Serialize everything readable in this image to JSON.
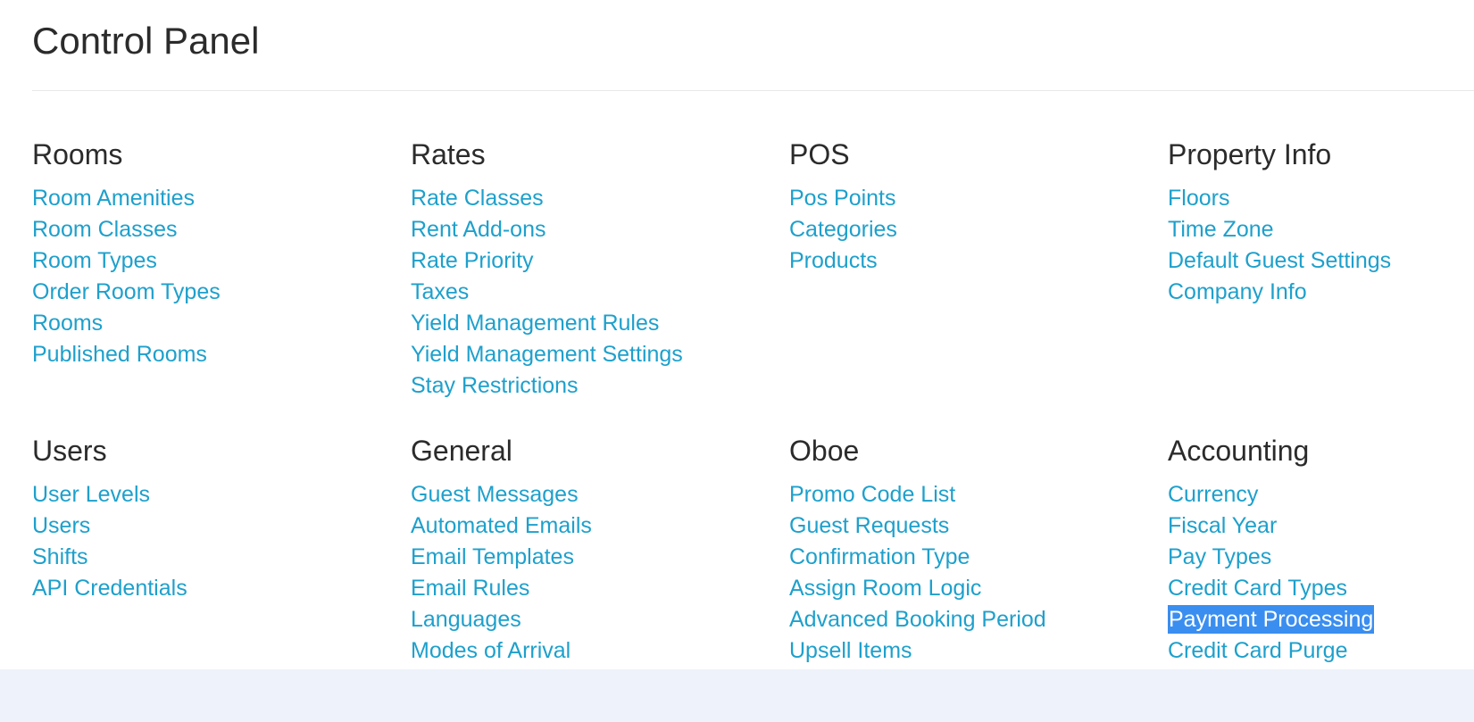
{
  "page": {
    "title": "Control Panel"
  },
  "sections": {
    "rooms": {
      "title": "Rooms",
      "links": [
        "Room Amenities",
        "Room Classes",
        "Room Types",
        "Order Room Types",
        "Rooms",
        "Published Rooms"
      ]
    },
    "rates": {
      "title": "Rates",
      "links": [
        "Rate Classes",
        "Rent Add-ons",
        "Rate Priority",
        "Taxes",
        "Yield Management Rules",
        "Yield Management Settings",
        "Stay Restrictions"
      ]
    },
    "pos": {
      "title": "POS",
      "links": [
        "Pos Points",
        "Categories",
        "Products"
      ]
    },
    "property_info": {
      "title": "Property Info",
      "links": [
        "Floors",
        "Time Zone",
        "Default Guest Settings",
        "Company Info"
      ]
    },
    "users": {
      "title": "Users",
      "links": [
        "User Levels",
        "Users",
        "Shifts",
        "API Credentials"
      ]
    },
    "general": {
      "title": "General",
      "links": [
        "Guest Messages",
        "Automated Emails",
        "Email Templates",
        "Email Rules",
        "Languages",
        "Modes of Arrival"
      ]
    },
    "oboe": {
      "title": "Oboe",
      "links": [
        "Promo Code List",
        "Guest Requests",
        "Confirmation Type",
        "Assign Room Logic",
        "Advanced Booking Period",
        "Upsell Items"
      ]
    },
    "accounting": {
      "title": "Accounting",
      "links": [
        "Currency",
        "Fiscal Year",
        "Pay Types",
        "Credit Card Types",
        "Payment Processing",
        "Credit Card Purge"
      ],
      "selected_index": 4
    }
  },
  "colors": {
    "link": "#1ea0cc",
    "heading": "#2b2b2b",
    "selection": "#3a8ef0",
    "footer": "#eef2fa"
  }
}
